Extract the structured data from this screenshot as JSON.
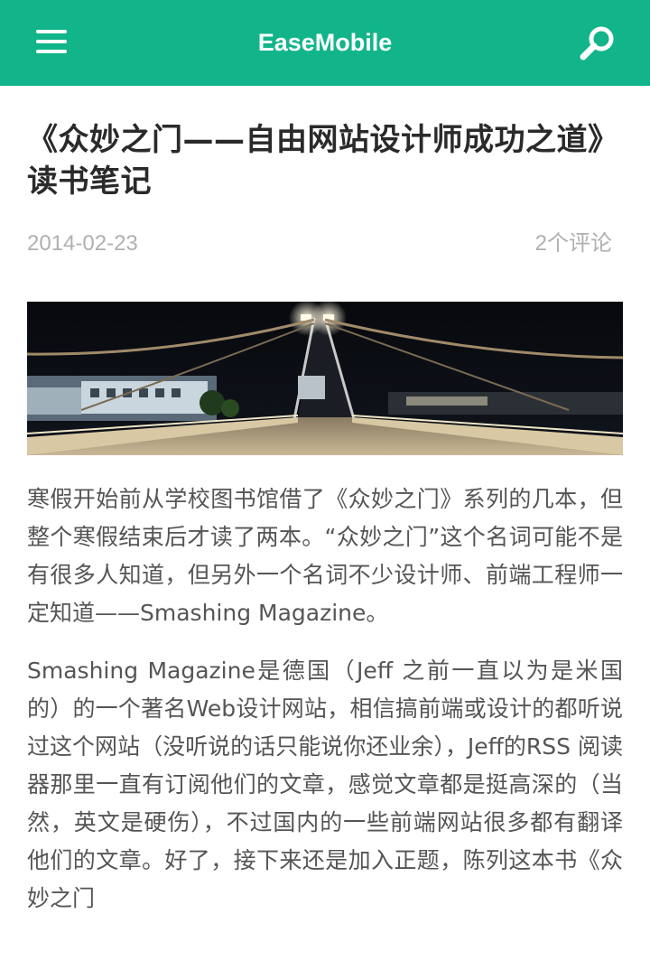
{
  "app": {
    "title": "EaseMobile"
  },
  "post": {
    "title": "《众妙之门——自由网站设计师成功之道》读书笔记",
    "date": "2014-02-23",
    "comments": "2个评论",
    "paragraphs": [
      "寒假开始前从学校图书馆借了《众妙之门》系列的几本，但整个寒假结束后才读了两本。“众妙之门”这个名词可能不是有很多人知道，但另外一个名词不少设计师、前端工程师一定知道——Smashing Magazine。",
      "Smashing Magazine是德国（Jeff 之前一直以为是米国的）的一个著名Web设计网站，相信搞前端或设计的都听说过这个网站（没听说的话只能说你还业余），Jeff的RSS 阅读器那里一直有订阅他们的文章，感觉文章都是挺高深的（当然，英文是硬伤），不过国内的一些前端网站很多都有翻译他们的文章。好了，接下来还是加入正题，陈列这本书《众妙之门"
    ]
  },
  "colors": {
    "brand": "#12b589",
    "meta": "#b0b0b0",
    "body_text": "#555555",
    "title_text": "#2a2a2a"
  },
  "icons": {
    "menu": "hamburger-icon",
    "search": "search-icon"
  }
}
